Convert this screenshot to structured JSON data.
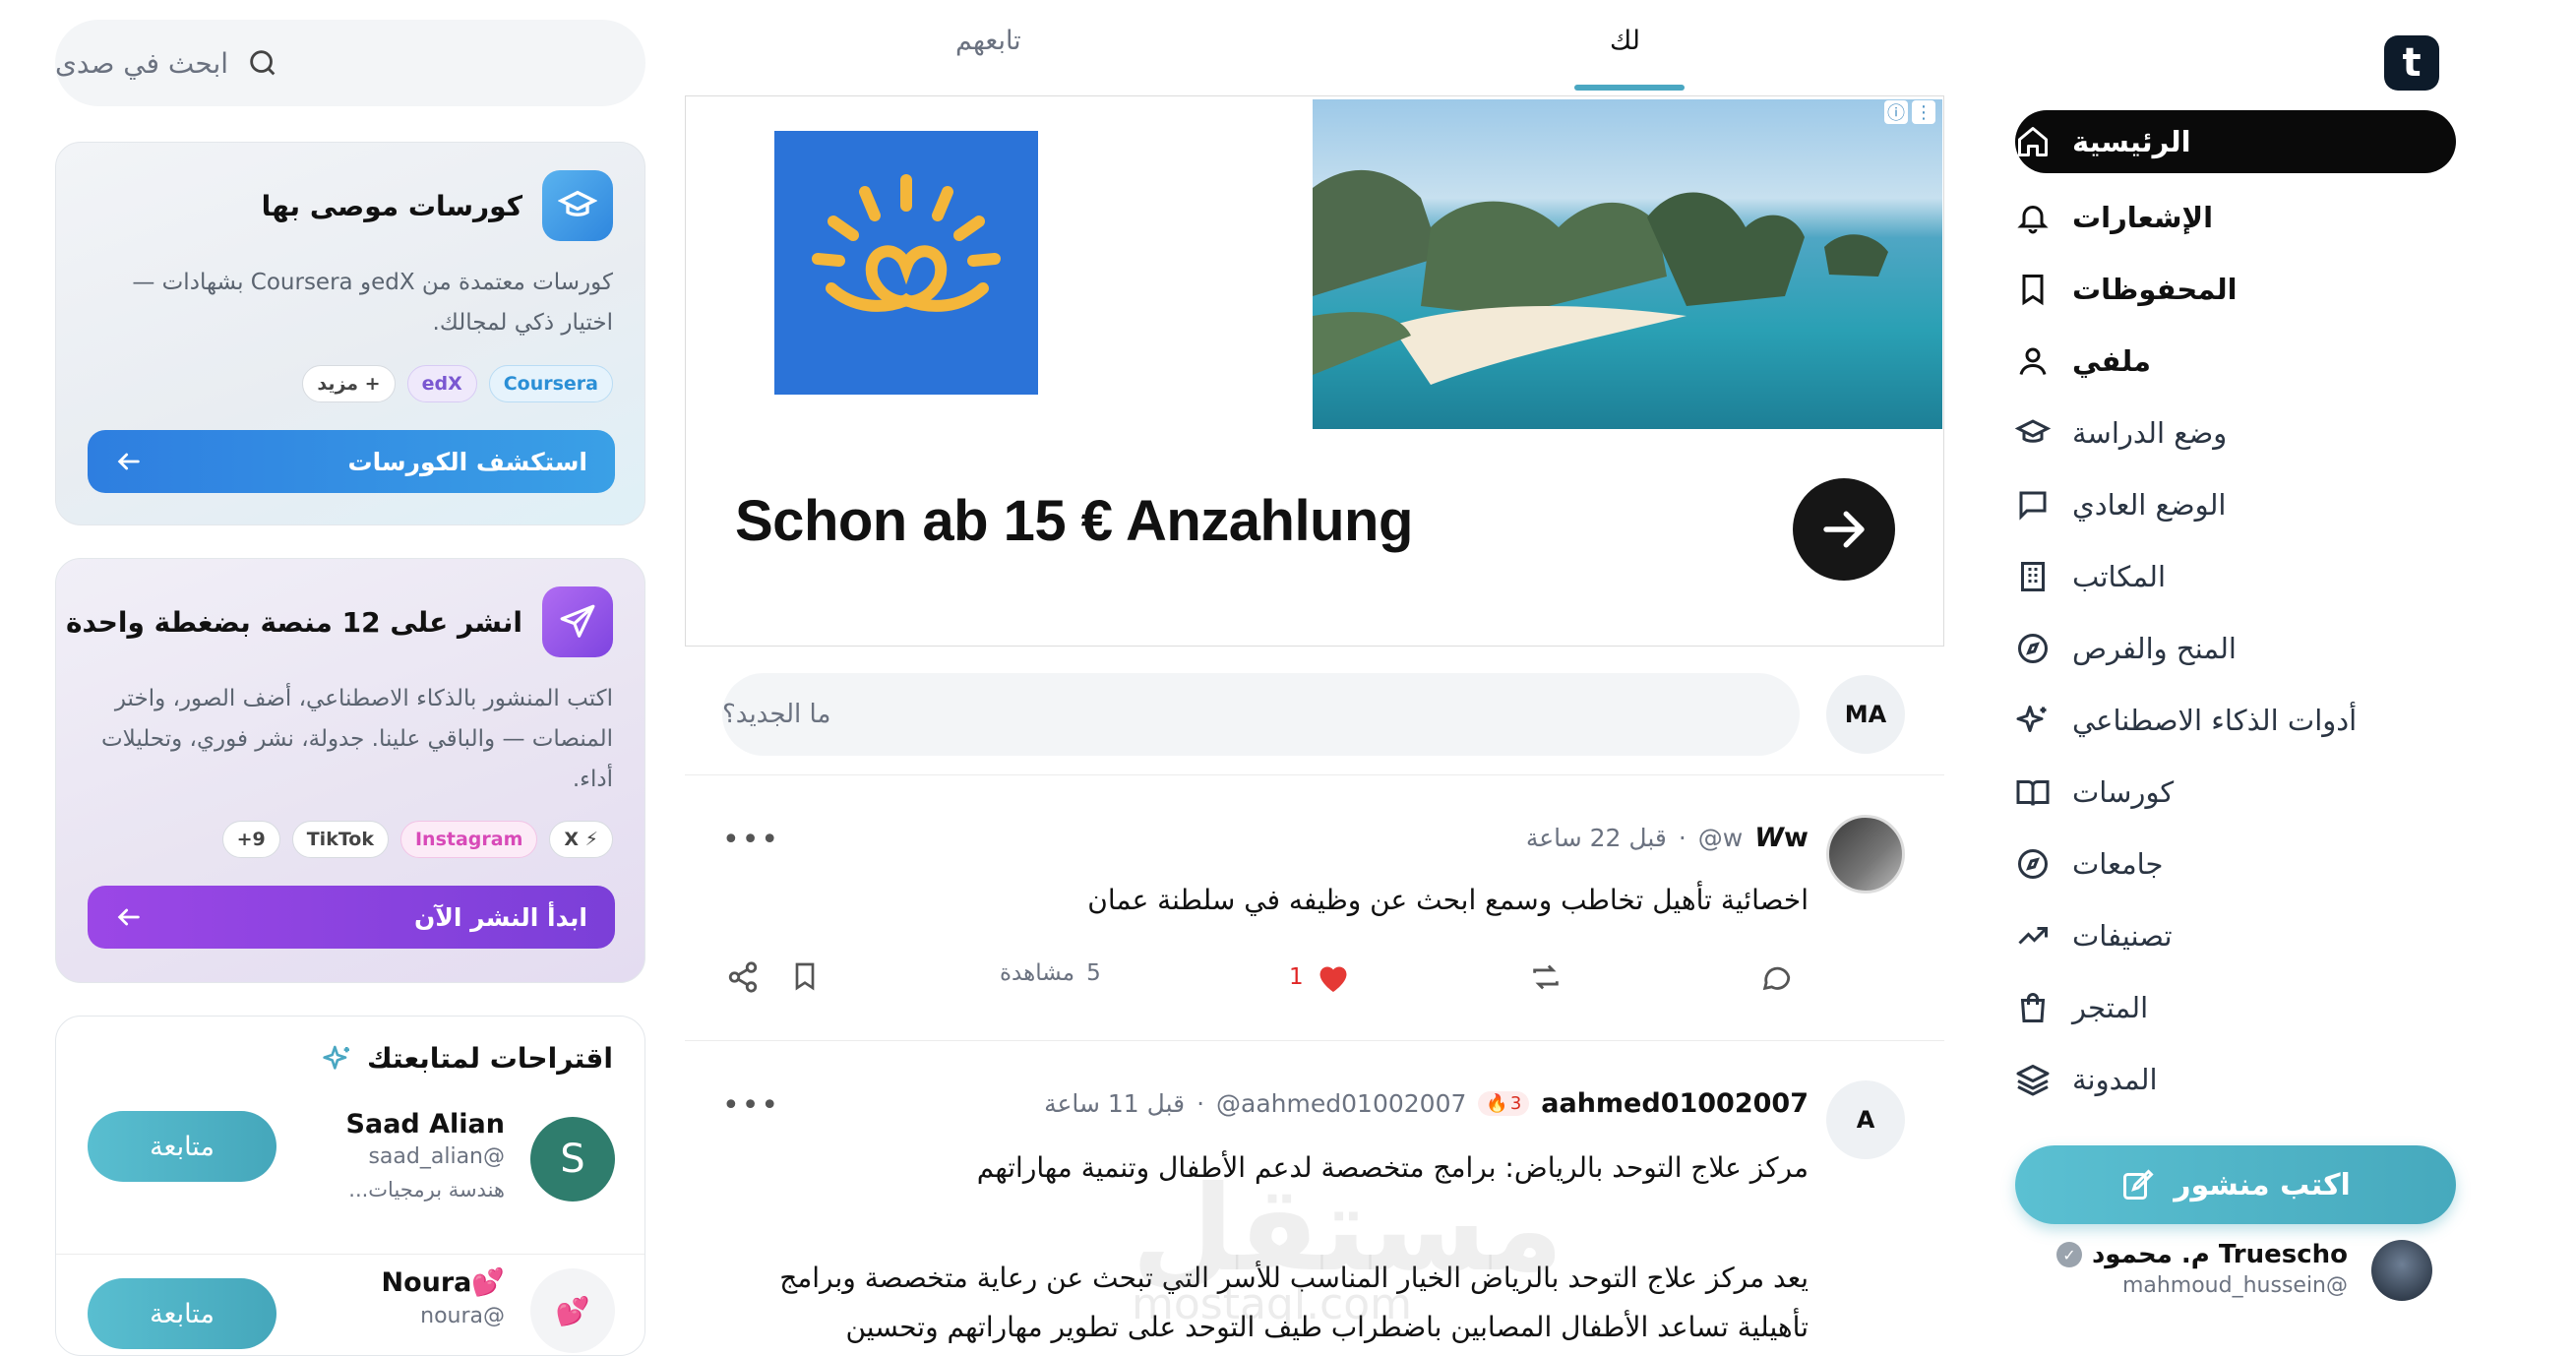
{
  "brand": {
    "logo_letter": "t",
    "accent": "#46a9bd"
  },
  "sidebar": {
    "items": [
      {
        "label": "الرئيسية",
        "icon": "home-icon",
        "active": true
      },
      {
        "label": "الإشعارات",
        "icon": "bell-icon"
      },
      {
        "label": "المحفوظات",
        "icon": "bookmark-icon"
      },
      {
        "label": "ملفي",
        "icon": "user-icon"
      },
      {
        "label": "وضع الدراسة",
        "icon": "graduation-cap-icon"
      },
      {
        "label": "الوضع العادي",
        "icon": "chat-icon"
      },
      {
        "label": "المكاتب",
        "icon": "building-icon"
      },
      {
        "label": "المنح والفرص",
        "icon": "compass-icon"
      },
      {
        "label": "أدوات الذكاء الاصطناعي",
        "icon": "sparkles-icon"
      },
      {
        "label": "كورسات",
        "icon": "book-open-icon"
      },
      {
        "label": "جامعات",
        "icon": "compass-icon"
      },
      {
        "label": "تصنيفات",
        "icon": "trending-icon"
      },
      {
        "label": "المتجر",
        "icon": "shopping-bag-icon"
      },
      {
        "label": "المدونة",
        "icon": "layers-icon"
      }
    ],
    "write_button": "اكتب منشور",
    "profile": {
      "name": "Truescho م. محمود",
      "handle": "mahmoud_hussein@"
    }
  },
  "feed": {
    "tabs": [
      {
        "label": "لك",
        "active": true
      },
      {
        "label": "تابعهم"
      }
    ],
    "ad": {
      "headline": "Schon ab 15 € Anzahlung"
    },
    "composer": {
      "placeholder": "ما الجديد؟",
      "avatar_initials": "MA"
    },
    "posts": [
      {
        "author": "w",
        "handle": "w@",
        "time": "قبل 22 ساعة",
        "text": "اخصائية تأهيل تخاطب  وسمع ابحث عن وظيفه في سلطنة عمان",
        "likes": "1",
        "views": "5",
        "views_label": "مشاهدة"
      },
      {
        "author": "aahmed01002007",
        "handle": "aahmed01002007@",
        "streak": "3",
        "time": "قبل 11 ساعة",
        "avatar_initial": "A",
        "text_lines": [
          "مركز علاج التوحد بالرياض: برامج متخصصة لدعم الأطفال وتنمية مهاراتهم",
          "يعد مركز علاج التوحد بالرياض الخيار المناسب للأسر التي تبحث عن رعاية متخصصة وبرامج",
          "تأهيلية تساعد الأطفال المصابين باضطراب طيف التوحد على تطوير مهاراتهم وتحسين"
        ]
      }
    ]
  },
  "right_panel": {
    "search_placeholder": "ابحث في صدى",
    "courses_card": {
      "title": "كورسات موصى بها",
      "description": "كورسات معتمدة من edXو Coursera بشهادات — اختيار ذكي لمجالك.",
      "chips": [
        "Coursera",
        "edX",
        "+ مزيد"
      ],
      "cta": "استكشف الكورسات"
    },
    "publish_card": {
      "title": "انشر على 12 منصة بضغطة واحدة",
      "description": "اكتب المنشور بالذكاء الاصطناعي، أضف الصور، واختر المنصات — والباقي علينا. جدولة، نشر فوري، وتحليلات أداء.",
      "chips": [
        "X",
        "Instagram",
        "TikTok",
        "+9"
      ],
      "cta": "ابدأ النشر الآن"
    },
    "suggestions": {
      "title": "اقتراحات لمتابعتك",
      "follow_label": "متابعة",
      "users": [
        {
          "name": "Saad Alian",
          "handle": "saad_alian@",
          "bio": "هندسة برمجيات...",
          "initial": "S"
        },
        {
          "name": "Noura💕",
          "handle": "noura@",
          "initial": "💕"
        }
      ]
    }
  },
  "watermark": {
    "arabic": "مستقل",
    "latin": "mostaql.com"
  }
}
